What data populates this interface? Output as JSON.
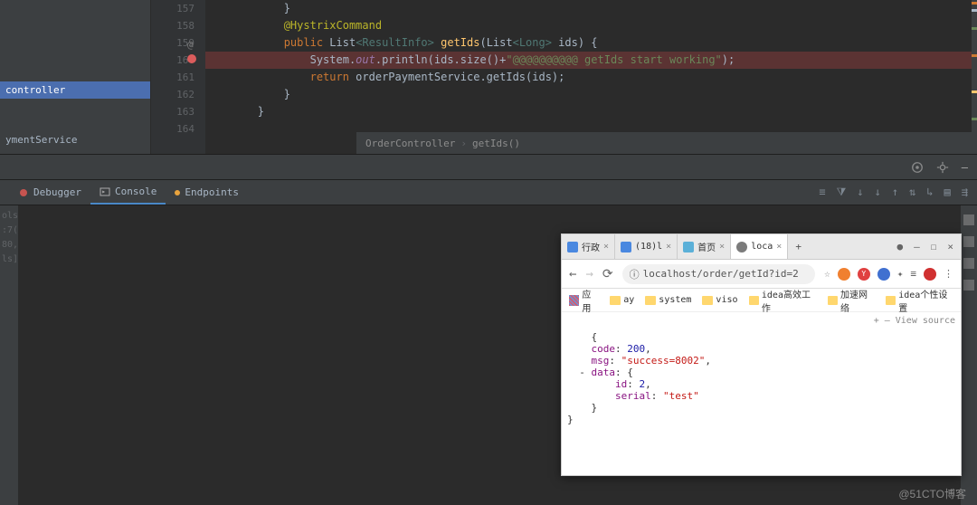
{
  "sidebar": {
    "items": [
      {
        "label": "controller",
        "selected": true
      },
      {
        "label": "",
        "selected": false
      },
      {
        "label": "ymentService",
        "selected": false
      }
    ]
  },
  "gutter": {
    "lines": [
      "157",
      "158",
      "159",
      "160",
      "161",
      "162",
      "163",
      "164"
    ],
    "at_marker": "@"
  },
  "code": {
    "l157": "            }",
    "l158_ann": "            @HystrixCommand",
    "l159": {
      "kw1": "public",
      "type": " List",
      "gen": "<ResultInfo>",
      "mth": " getIds",
      "rest": "(List",
      "gen2": "<Long>",
      "rest2": " ids) {"
    },
    "l160": {
      "pre": "                System.",
      "fld": "out",
      "mid": ".println(ids.size()+",
      "str": "\"@@@@@@@@@@ getIds start working\"",
      "post": ");"
    },
    "l161": {
      "kw": "return",
      "rest": " orderPaymentService.getIds(ids);"
    },
    "l162": "            }",
    "l163": "        }",
    "l164": ""
  },
  "breadcrumb": {
    "a": "OrderController",
    "b": "getIds()"
  },
  "bottom_tabs": {
    "debugger": "Debugger",
    "console": "Console",
    "endpoints": "Endpoints"
  },
  "left_thin": "ols\n:7(\n80,\nls]",
  "browser": {
    "tabs": [
      {
        "label": "行政",
        "color": "#4a88e0"
      },
      {
        "label": "(18)l",
        "color": "#4a88e0"
      },
      {
        "label": "首页",
        "color": "#5bb0d8"
      },
      {
        "label": "loca",
        "color": "#7b7b7b",
        "active": true
      }
    ],
    "url_prefix": "ⓘ",
    "url": "localhost/order/getId?id=2",
    "bookmarks_apps": "应用",
    "bookmarks": [
      "ay",
      "system",
      "viso",
      "idea高效工作",
      "加速网络",
      "idea个性设置"
    ],
    "response": {
      "code_k": "code",
      "code_v": "200",
      "msg_k": "msg",
      "msg_v": "\"success=8002\"",
      "data_k": "data",
      "id_k": "id",
      "id_v": "2",
      "serial_k": "serial",
      "serial_v": "\"test\""
    },
    "view_source": "+ ‒ View source"
  },
  "watermark": "@51CTO博客"
}
